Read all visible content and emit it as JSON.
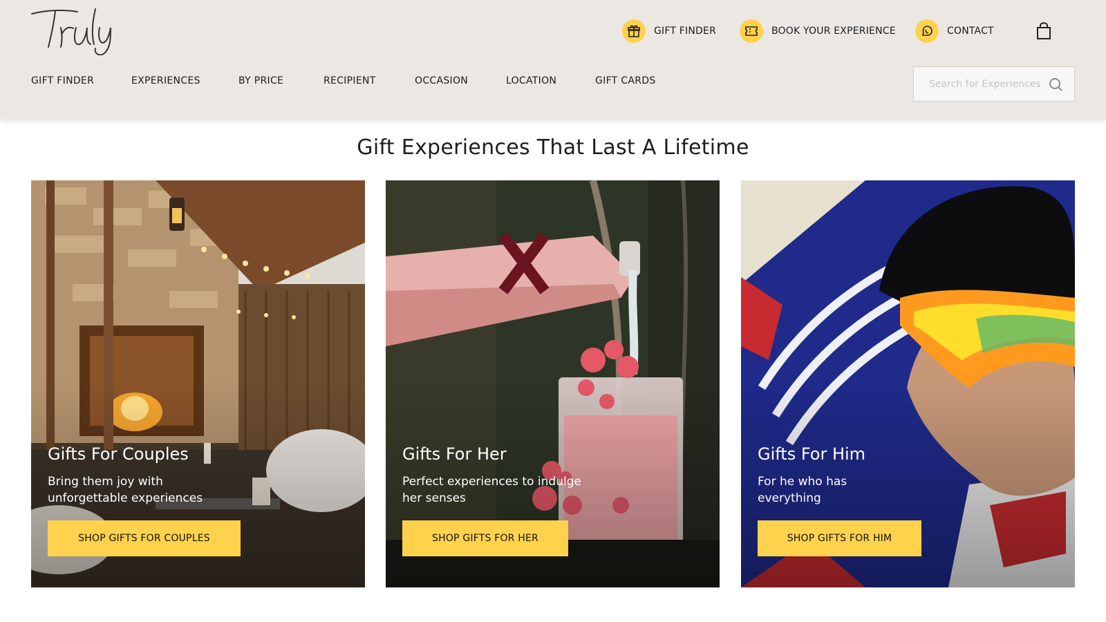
{
  "brand": {
    "logo_text": "Truly"
  },
  "header": {
    "utility": [
      {
        "icon": "gift-icon",
        "label": "GIFT FINDER"
      },
      {
        "icon": "ticket-icon",
        "label": "BOOK YOUR EXPERIENCE"
      },
      {
        "icon": "whatsapp-icon",
        "label": "CONTACT"
      }
    ],
    "cart_icon": "shopping-bag-icon",
    "nav": [
      "GIFT FINDER",
      "EXPERIENCES",
      "BY PRICE",
      "RECIPIENT",
      "OCCASION",
      "LOCATION",
      "GIFT CARDS"
    ],
    "search": {
      "placeholder": "Search for Experiences",
      "value": ""
    }
  },
  "main": {
    "headline": "Gift Experiences That Last A Lifetime",
    "cards": [
      {
        "title": "Gifts For Couples",
        "description": "Bring them joy with unforgettable experiences",
        "button": "SHOP GIFTS FOR COUPLES"
      },
      {
        "title": "Gifts For Her",
        "description": "Perfect experiences to indulge her senses",
        "button": "SHOP GIFTS FOR HER"
      },
      {
        "title": "Gifts For Him",
        "description": "For he who has everything",
        "button": "SHOP GIFTS FOR HIM"
      }
    ]
  },
  "colors": {
    "accent": "#ffd24d",
    "header_bg": "#ebe8e4",
    "text": "#1b1b1b"
  }
}
